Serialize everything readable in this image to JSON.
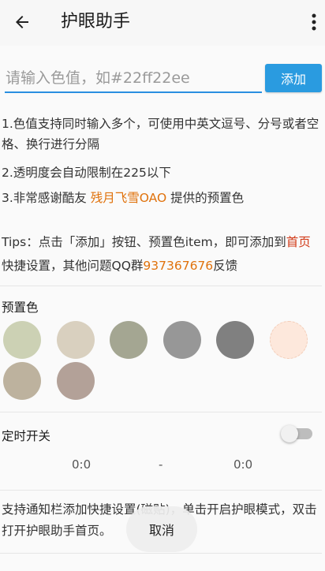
{
  "appbar": {
    "title": "护眼助手",
    "back_icon": "arrow-back-icon",
    "more_icon": "more-vert-icon"
  },
  "color_input": {
    "placeholder": "请输入色值，如#22ff22ee",
    "value": ""
  },
  "add_button": {
    "label": "添加"
  },
  "instructions": {
    "line1": "1.色值支持同时输入多个，可使用中英文逗号、分号或者空格、换行进行分隔",
    "line2": "2.透明度会自动限制在225以下",
    "line3_prefix": "3.非常感谢酷友 ",
    "line3_name": "残月飞雪OAO",
    "line3_suffix": " 提供的预置色"
  },
  "tips": {
    "prefix": "Tips：点击「添加」按钮、预置色item，即可添加到",
    "home": "首页",
    "middle": "快捷设置，其他问题QQ群",
    "qq": "937367676",
    "suffix": "反馈"
  },
  "presets": {
    "label": "预置色",
    "colors": [
      "#ccd1b4",
      "#d9d0bf",
      "#a4a692",
      "#979797",
      "#808080",
      "#fde8dc",
      "#bdb29e",
      "#b3a198"
    ]
  },
  "timer": {
    "label": "定时开关",
    "enabled": false,
    "start": "0:0",
    "separator": "-",
    "end": "0:0"
  },
  "notification_note": "支持通知栏添加快捷设置(磁贴)，单击开启护眼模式，双击打开护眼助手首页。",
  "cancel_label": "取消",
  "colors": {
    "accent_blue": "#2a9be0",
    "accent_orange": "#e0720c",
    "accent_red": "#d23c1a"
  }
}
